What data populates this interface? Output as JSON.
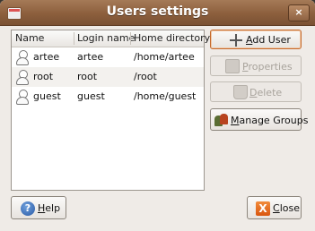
{
  "window": {
    "title": "Users settings",
    "close_symbol": "×"
  },
  "table": {
    "columns": [
      "Name",
      "Login name",
      "Home directory"
    ],
    "rows": [
      {
        "name": "artee",
        "login": "artee",
        "home": "/home/artee"
      },
      {
        "name": "root",
        "login": "root",
        "home": "/root"
      },
      {
        "name": "guest",
        "login": "guest",
        "home": "/home/guest"
      }
    ]
  },
  "buttons": {
    "add_user": {
      "mnemonic": "A",
      "rest": "dd User",
      "icon": "plus-icon",
      "enabled": true
    },
    "properties": {
      "mnemonic": "P",
      "rest": "roperties",
      "icon": "properties-icon",
      "enabled": false
    },
    "delete": {
      "mnemonic": "D",
      "rest": "elete",
      "icon": "trash-icon",
      "enabled": false
    },
    "manage_groups": {
      "mnemonic": "M",
      "rest": "anage Groups",
      "icon": "users-group-icon",
      "enabled": true
    },
    "help": {
      "mnemonic": "H",
      "rest": "elp",
      "icon": "help-icon",
      "glyph": "?"
    },
    "close": {
      "mnemonic": "C",
      "rest": "lose",
      "icon": "close-icon",
      "glyph": "X"
    }
  },
  "colors": {
    "titlebar": "#8c5f3d",
    "focus_border": "#c46a2c"
  }
}
